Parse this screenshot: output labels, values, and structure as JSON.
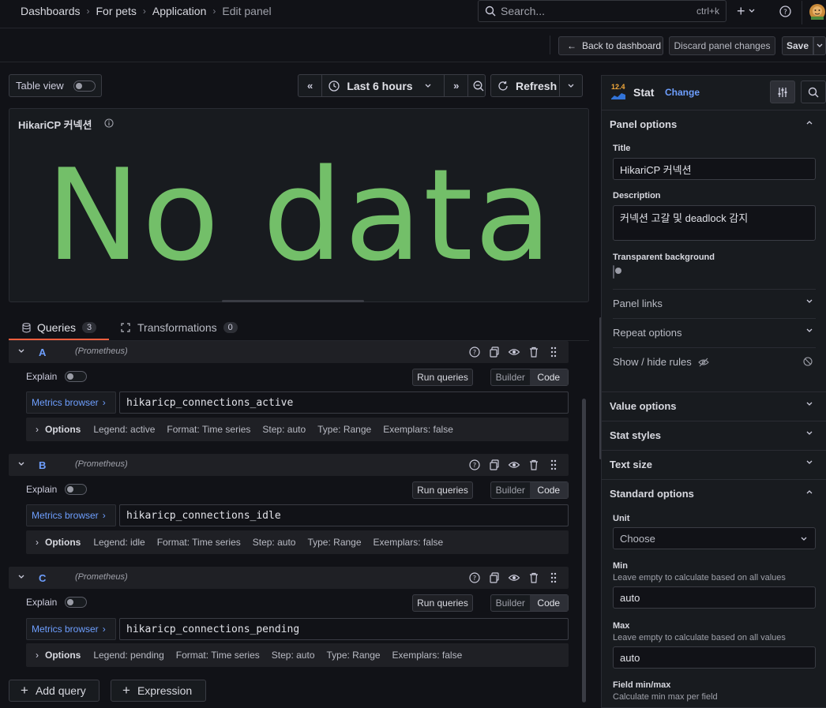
{
  "breadcrumbs": [
    "Dashboards",
    "For pets",
    "Application",
    "Edit panel"
  ],
  "search": {
    "placeholder": "Search...",
    "shortcut": "ctrl+k"
  },
  "actions": {
    "back": "Back to dashboard",
    "discard": "Discard panel changes",
    "save": "Save"
  },
  "toolbar": {
    "table_view": "Table view",
    "time_range": "Last 6 hours",
    "refresh": "Refresh"
  },
  "panel": {
    "title": "HikariCP 커넥션",
    "no_data": "No data"
  },
  "tabs": [
    {
      "label": "Queries",
      "count": "3"
    },
    {
      "label": "Transformations",
      "count": "0"
    }
  ],
  "queries": [
    {
      "letter": "A",
      "datasource": "(Prometheus)",
      "expr": "hikaricp_connections_active",
      "legend": "Legend: active",
      "format": "Format: Time series",
      "step": "Step: auto",
      "type": "Type: Range",
      "exemplars": "Exemplars: false"
    },
    {
      "letter": "B",
      "datasource": "(Prometheus)",
      "expr": "hikaricp_connections_idle",
      "legend": "Legend: idle",
      "format": "Format: Time series",
      "step": "Step: auto",
      "type": "Type: Range",
      "exemplars": "Exemplars: false"
    },
    {
      "letter": "C",
      "datasource": "(Prometheus)",
      "expr": "hikaricp_connections_pending",
      "legend": "Legend: pending",
      "format": "Format: Time series",
      "step": "Step: auto",
      "type": "Type: Range",
      "exemplars": "Exemplars: false"
    }
  ],
  "query_ui": {
    "explain": "Explain",
    "run": "Run queries",
    "builder": "Builder",
    "code": "Code",
    "metrics_browser": "Metrics browser",
    "options": "Options"
  },
  "add": {
    "query": "Add query",
    "expression": "Expression"
  },
  "viz": {
    "version": "12.4",
    "name": "Stat",
    "change": "Change"
  },
  "options": {
    "panel_options": "Panel options",
    "title_label": "Title",
    "title_value": "HikariCP 커넥션",
    "description_label": "Description",
    "description_value": "커넥션 고갈 및 deadlock 감지",
    "transparent_label": "Transparent background",
    "panel_links": "Panel links",
    "repeat_options": "Repeat options",
    "show_hide_rules": "Show / hide rules",
    "value_options": "Value options",
    "stat_styles": "Stat styles",
    "text_size": "Text size",
    "standard_options": "Standard options",
    "unit_label": "Unit",
    "unit_value": "Choose",
    "min_label": "Min",
    "min_desc": "Leave empty to calculate based on all values",
    "min_value": "auto",
    "max_label": "Max",
    "max_desc": "Leave empty to calculate based on all values",
    "max_value": "auto",
    "field_minmax_label": "Field min/max",
    "field_minmax_desc": "Calculate min max per field"
  },
  "colors": {
    "accent": "#6e9fff",
    "no_data": "#73bf69",
    "background": "#111217"
  }
}
